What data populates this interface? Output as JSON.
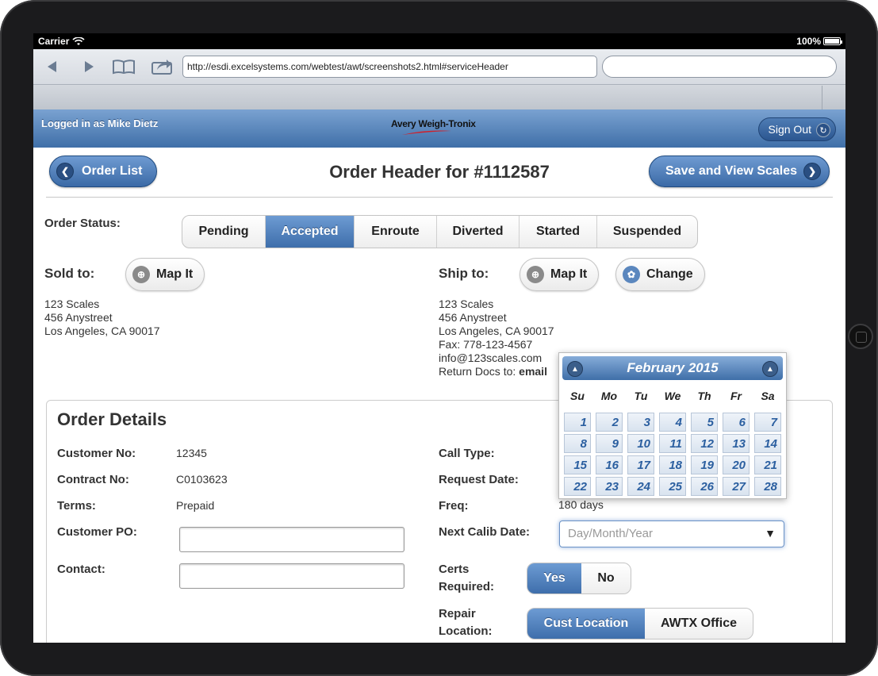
{
  "status_bar": {
    "carrier": "Carrier",
    "battery": "100%"
  },
  "browser": {
    "url": "http://esdi.excelsystems.com/webtest/awt/screenshots2.html#serviceHeader",
    "search_placeholder": ""
  },
  "header": {
    "logged_in": "Logged in as Mike Dietz",
    "logo": "Avery Weigh-Tronix",
    "sign_out": "Sign Out"
  },
  "nav": {
    "order_list": "Order List",
    "title": "Order Header for #1112587",
    "save_view": "Save and View Scales"
  },
  "order_status": {
    "label": "Order Status:",
    "options": [
      "Pending",
      "Accepted",
      "Enroute",
      "Diverted",
      "Started",
      "Suspended"
    ],
    "selected": "Accepted"
  },
  "sold_to": {
    "label": "Sold to:",
    "map_it": "Map It",
    "lines": [
      "123 Scales",
      "456 Anystreet",
      "Los Angeles, CA 90017"
    ]
  },
  "ship_to": {
    "label": "Ship to:",
    "map_it": "Map It",
    "change": "Change",
    "lines": [
      "123 Scales",
      "456 Anystreet",
      "Los Angeles, CA 90017",
      "Fax: 778-123-4567",
      "info@123scales.com"
    ],
    "return_docs": "Return Docs to:",
    "return_docs_value": "email"
  },
  "details": {
    "title": "Order Details",
    "customer_no_label": "Customer No:",
    "customer_no": "12345",
    "contract_no_label": "Contract No:",
    "contract_no": "C0103623",
    "terms_label": "Terms:",
    "terms": "Prepaid",
    "customer_po_label": "Customer PO:",
    "contact_label": "Contact:",
    "call_type_label": "Call Type:",
    "request_date_label": "Request Date:",
    "freq_label": "Freq:",
    "freq": "180 days",
    "next_calib_label": "Next Calib Date:",
    "next_calib_placeholder": "Day/Month/Year",
    "certs_label_1": "Certs",
    "certs_label_2": "Required:",
    "certs_options": [
      "Yes",
      "No"
    ],
    "repair_label_1": "Repair",
    "repair_label_2": "Location:",
    "repair_options": [
      "Cust Location",
      "AWTX Office"
    ]
  },
  "calendar": {
    "month": "February 2015",
    "dow": [
      "Su",
      "Mo",
      "Tu",
      "We",
      "Th",
      "Fr",
      "Sa"
    ],
    "days": [
      "1",
      "2",
      "3",
      "4",
      "5",
      "6",
      "7",
      "8",
      "9",
      "10",
      "11",
      "12",
      "13",
      "14",
      "15",
      "16",
      "17",
      "18",
      "19",
      "20",
      "21",
      "22",
      "23",
      "24",
      "25",
      "26",
      "27",
      "28"
    ]
  }
}
